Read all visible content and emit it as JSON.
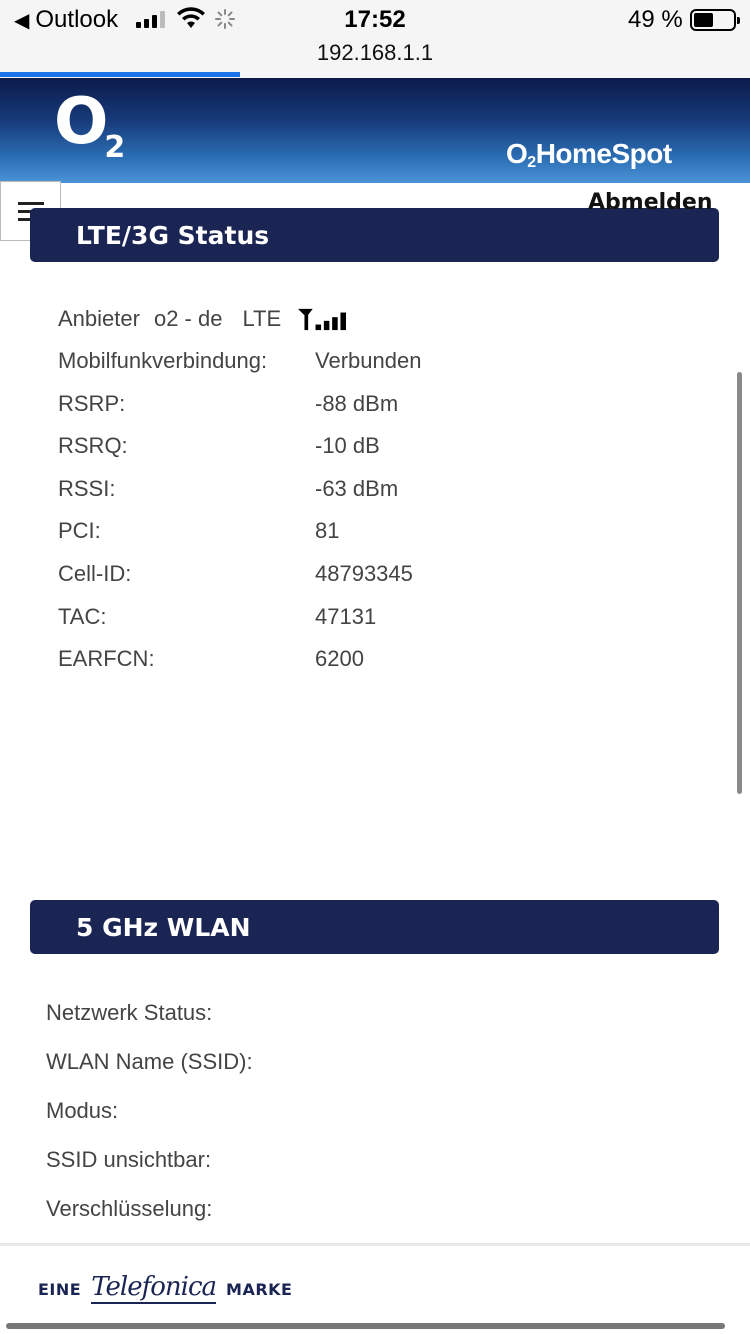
{
  "statusbar": {
    "back_app": "Outlook",
    "time": "17:52",
    "battery_pct": "49 %",
    "battery_level": 0.49,
    "signal_bars_filled": 3,
    "url": "192.168.1.1",
    "page_load_progress": 0.32
  },
  "header": {
    "logo": "O2",
    "product_brand": "O2",
    "product_name": "HomeSpot",
    "logout_label": "Abmelden"
  },
  "lte": {
    "title": "LTE/3G Status",
    "provider_label": "Anbieter",
    "provider_value": "o2 - de",
    "network_type": "LTE",
    "signal_bars": 4,
    "rows": [
      {
        "label": "Mobilfunkverbindung:",
        "value": "Verbunden"
      },
      {
        "label": "RSRP:",
        "value": "-88 dBm"
      },
      {
        "label": "RSRQ:",
        "value": "-10 dB"
      },
      {
        "label": "RSSI:",
        "value": "-63 dBm"
      },
      {
        "label": "PCI:",
        "value": "81"
      },
      {
        "label": "Cell-ID:",
        "value": "48793345"
      },
      {
        "label": "TAC:",
        "value": "47131"
      },
      {
        "label": "EARFCN:",
        "value": "6200"
      }
    ]
  },
  "wlan5": {
    "title": "5 GHz WLAN",
    "rows": [
      {
        "label": "Netzwerk Status:"
      },
      {
        "label": "WLAN Name (SSID):"
      },
      {
        "label": "Modus:"
      },
      {
        "label": "SSID unsichtbar:"
      },
      {
        "label": "Verschlüsselung:"
      }
    ]
  },
  "footer": {
    "prefix": "EINE",
    "brand": "Telefonica",
    "suffix": "MARKE"
  },
  "colors": {
    "section_bar": "#1a2554",
    "load_bar": "#1a73e8"
  }
}
